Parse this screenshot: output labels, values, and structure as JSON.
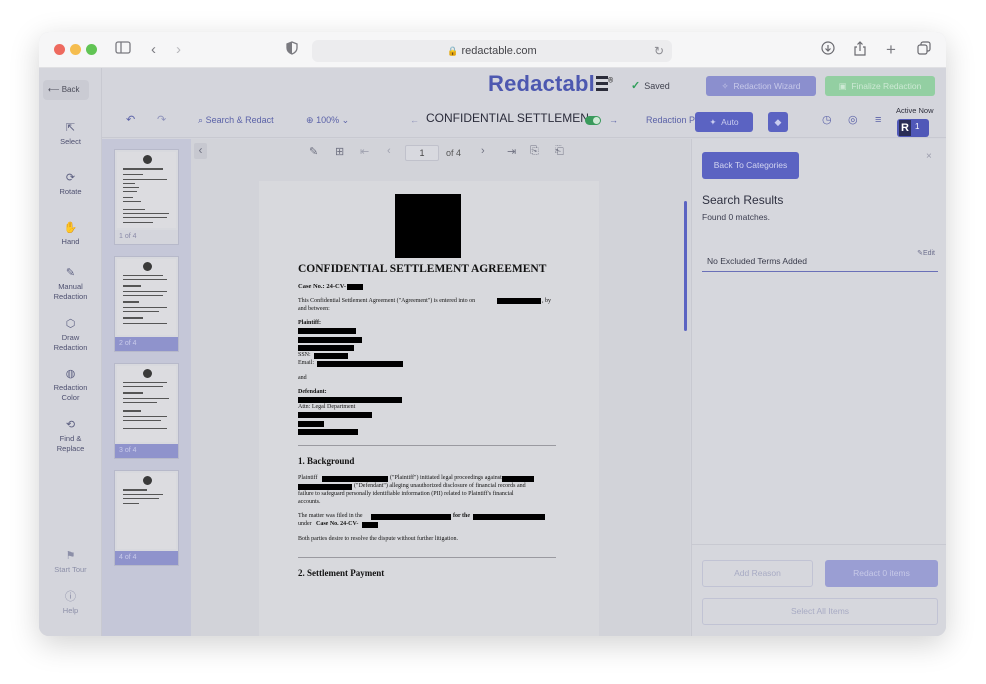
{
  "browser": {
    "url": "redactable.com"
  },
  "app": {
    "logo_text": "Redactabl",
    "logo_mark": "®",
    "saved_label": "Saved",
    "wizard_button": "Redaction Wizard",
    "finalize_button": "Finalize Redaction",
    "active_now_label": "Active Now",
    "avatar_letter": "R",
    "active_count": "1"
  },
  "sidebar": {
    "back_label": "Back",
    "tools": [
      {
        "label": "Select",
        "icon": "pointer-icon"
      },
      {
        "label": "Rotate",
        "icon": "rotate-icon"
      },
      {
        "label": "Hand",
        "icon": "hand-icon"
      },
      {
        "label": "Manual Redaction",
        "icon": "marker-icon"
      },
      {
        "label": "Draw Redaction",
        "icon": "shape-icon"
      },
      {
        "label": "Redaction Color",
        "icon": "palette-icon"
      },
      {
        "label": "Find & Replace",
        "icon": "replace-icon"
      }
    ],
    "start_tour": "Start Tour",
    "help": "Help"
  },
  "toolbar": {
    "search_redact": "Search & Redact",
    "zoom": "100%",
    "document_title": "CONFIDENTIAL SETTLEMEN...",
    "redaction_preview": "Redaction Preview",
    "auto_button": "Auto"
  },
  "viewer": {
    "current_page": "1",
    "of_pages": "of 4"
  },
  "thumbnails": [
    {
      "caption": "1 of 4"
    },
    {
      "caption": "2 of 4"
    },
    {
      "caption": "3 of 4"
    },
    {
      "caption": "4 of 4"
    }
  ],
  "document": {
    "title": "CONFIDENTIAL SETTLEMENT AGREEMENT",
    "case_label": "Case No.: 24-CV-",
    "intro": "This Confidential Settlement Agreement (\"Agreement\") is entered into on",
    "intro_end": ", by",
    "intro_line2": "and between:",
    "plaintiff_label": "Plaintiff:",
    "ssn_label": "SSN:",
    "email_label": "Email:",
    "and_label": "and",
    "defendant_label": "Defendant:",
    "attn_label": "Attn: Legal Department",
    "section1": "1. Background",
    "bg_line1a": "Plaintiff",
    "bg_line1b": "(\"Plaintiff\") initiated legal proceedings against",
    "bg_line2": "(\"Defendant\") alleging unauthorized disclosure of financial records and",
    "bg_line3": "failure to safeguard personally identifiable information (PII) related to Plaintiff's financial",
    "bg_line4": "accounts.",
    "filed_a": "The matter was filed in the",
    "filed_b": "for the",
    "filed_c": "under",
    "filed_case": "Case No. 24-CV-",
    "resolve": "Both parties desire to resolve the dispute without further litigation.",
    "section2": "2. Settlement Payment"
  },
  "panel": {
    "back_categories": "Back To Categories",
    "results_title": "Search Results",
    "found": "Found 0 matches.",
    "excluded": "No Excluded Terms Added",
    "edit": "Edit",
    "add_reason": "Add Reason",
    "redact_items": "Redact 0 items",
    "select_all": "Select All Items"
  }
}
